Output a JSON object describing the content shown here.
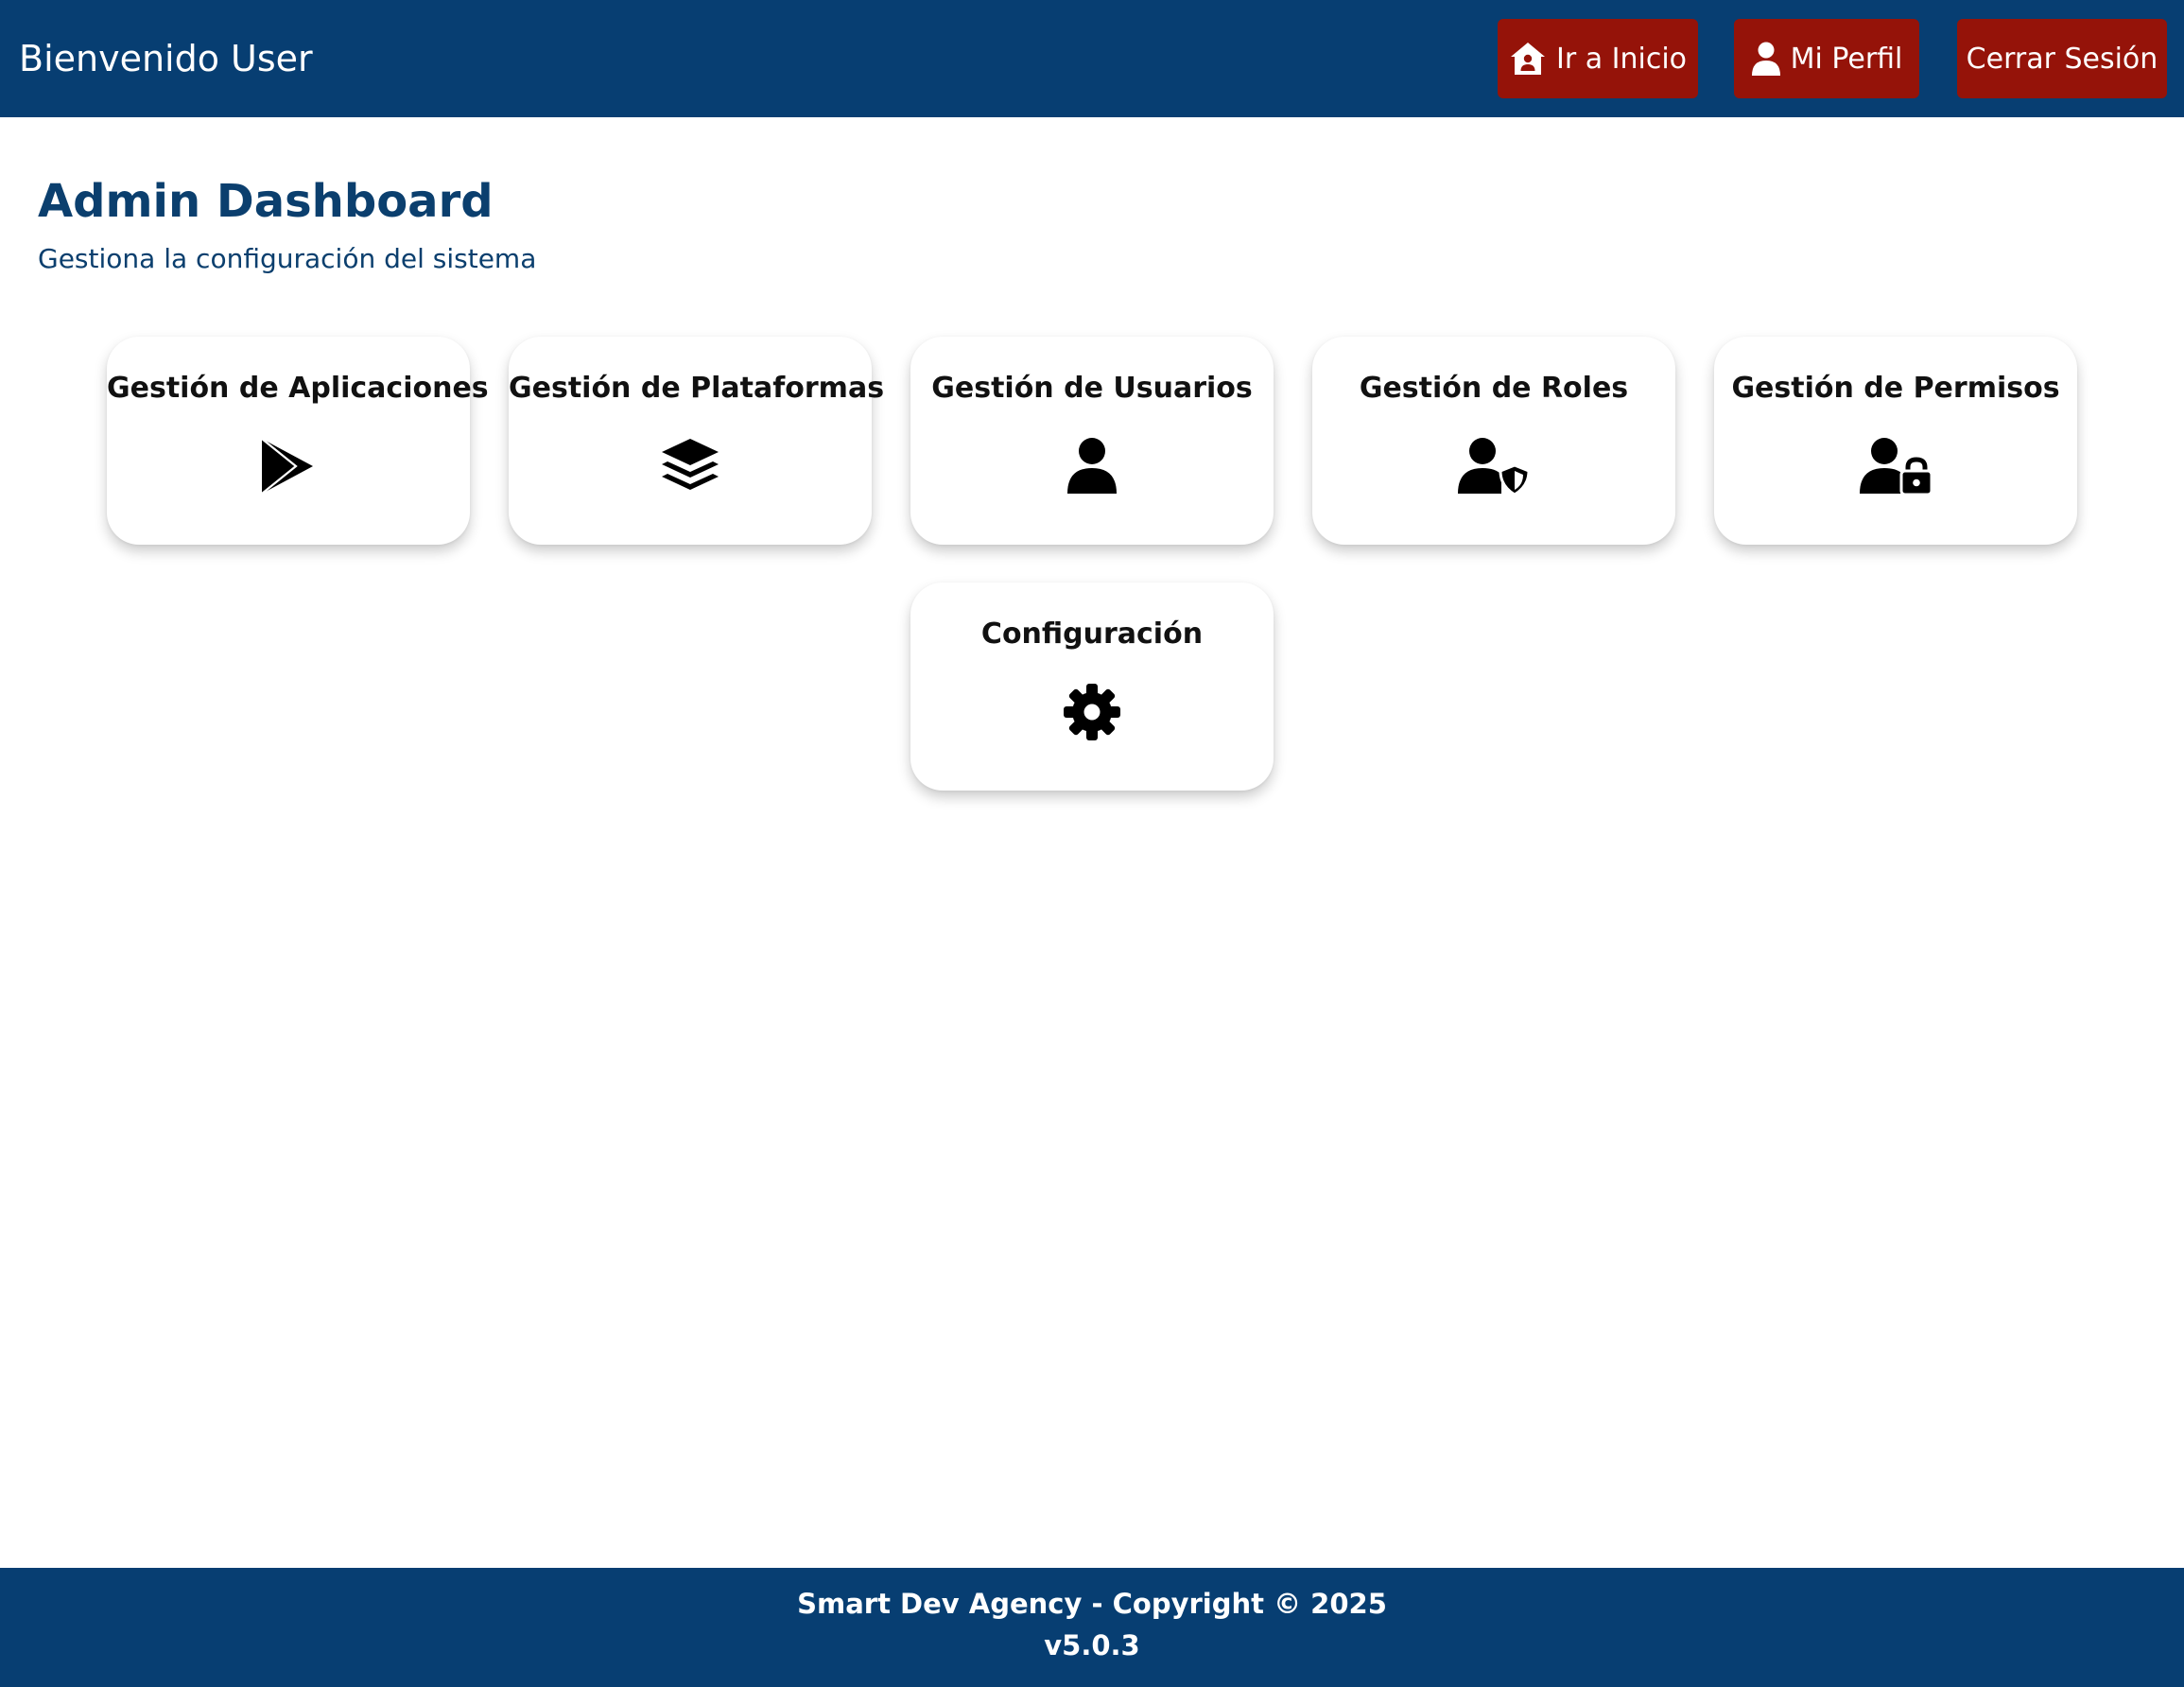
{
  "header": {
    "welcome": "Bienvenido User",
    "buttons": {
      "home": {
        "label": "Ir a Inicio",
        "icon": "house-user-icon"
      },
      "profile": {
        "label": "Mi Perfil",
        "icon": "user-icon"
      },
      "logout": {
        "label": "Cerrar Sesión"
      }
    }
  },
  "main": {
    "title": "Admin Dashboard",
    "subtitle": "Gestiona la configuración del sistema",
    "cards": [
      {
        "label": "Gestión de Aplicaciones",
        "icon": "google-play-icon"
      },
      {
        "label": "Gestión de Plataformas",
        "icon": "layers-icon"
      },
      {
        "label": "Gestión de Usuarios",
        "icon": "user-icon"
      },
      {
        "label": "Gestión de Roles",
        "icon": "user-shield-icon"
      },
      {
        "label": "Gestión de Permisos",
        "icon": "user-lock-icon"
      },
      {
        "label": "Configuración",
        "icon": "gear-icon"
      }
    ]
  },
  "footer": {
    "copyright": "Smart Dev Agency - Copyright © 2025",
    "version": "v5.0.3"
  },
  "colors": {
    "header_bg": "#073e72",
    "button_bg": "#951309",
    "title": "#0b3f6e",
    "card_bg": "#ffffff"
  }
}
